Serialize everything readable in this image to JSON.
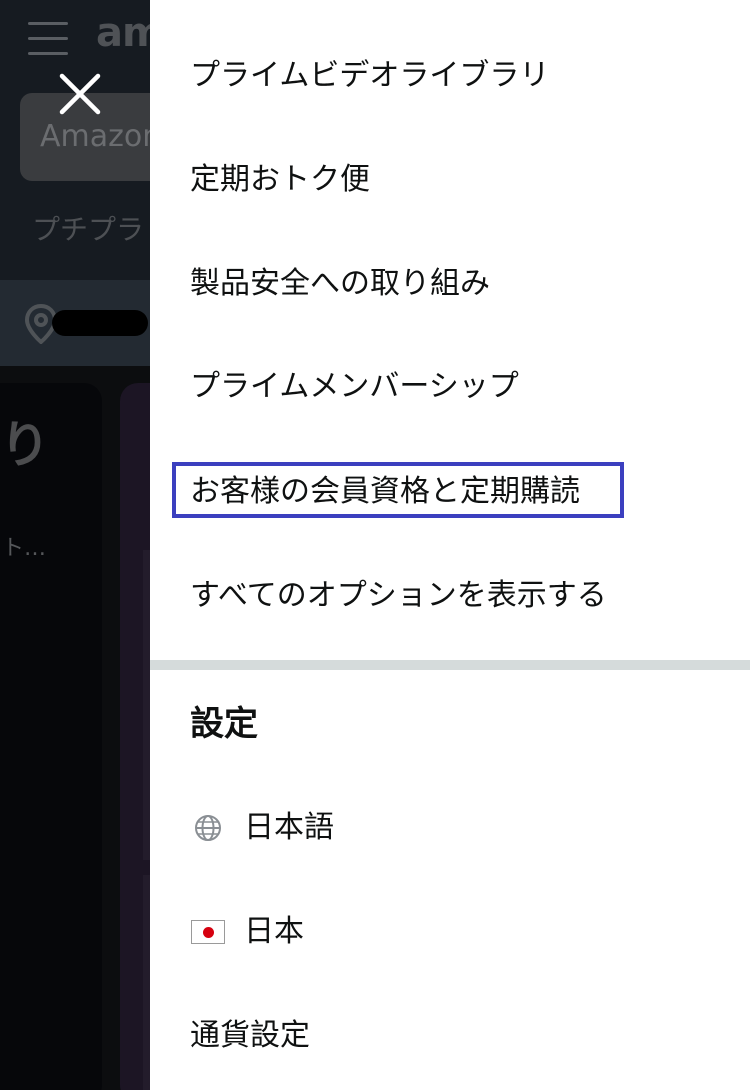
{
  "background": {
    "logo_text": "am",
    "search_placeholder": "Amazon",
    "subnav_text": "プチプラ",
    "card_char": "り",
    "card_sub": "ト…"
  },
  "drawer": {
    "menu_items": [
      {
        "label": "プライムビデオライブラリ"
      },
      {
        "label": "定期おトク便"
      },
      {
        "label": "製品安全への取り組み"
      },
      {
        "label": "プライムメンバーシップ"
      },
      {
        "label": "お客様の会員資格と定期購読",
        "highlighted": true
      },
      {
        "label": "すべてのオプションを表示する"
      }
    ],
    "settings": {
      "title": "設定",
      "language_label": "日本語",
      "country_label": "日本",
      "currency_label": "通貨設定"
    }
  },
  "colors": {
    "highlight_border": "#3b3fbf",
    "divider": "#d5dbdb",
    "flag_red": "#d6000f"
  },
  "icons": {
    "close": "close-icon",
    "menu": "hamburger-icon",
    "location": "location-pin-icon",
    "language": "globe-icon",
    "country": "japan-flag-icon"
  }
}
